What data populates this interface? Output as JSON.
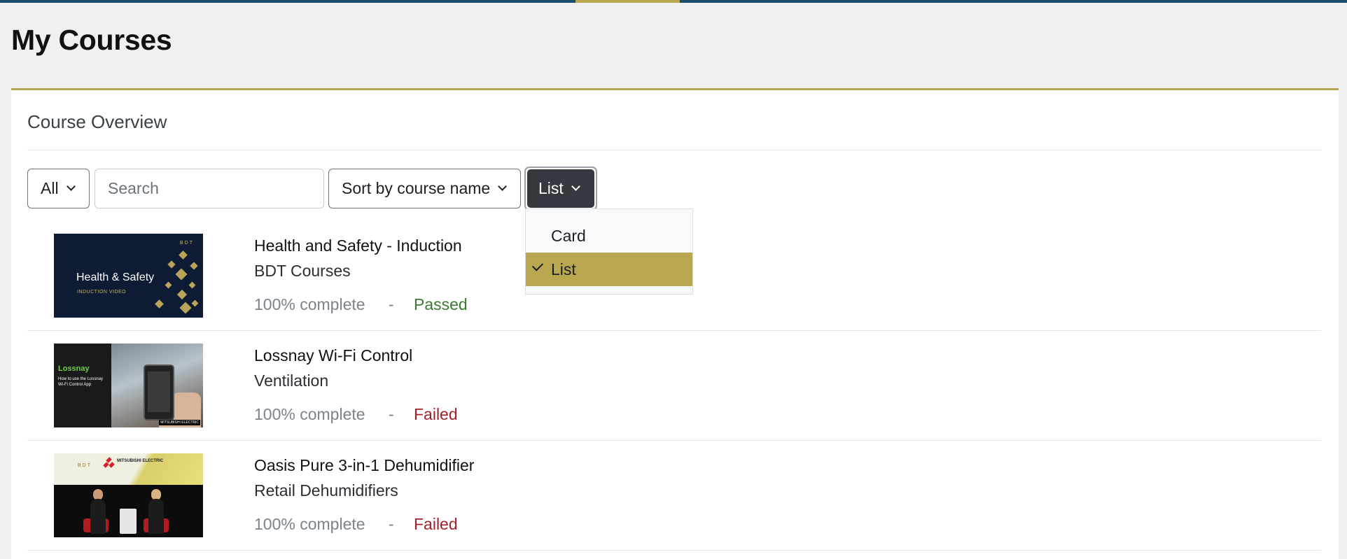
{
  "page": {
    "title": "My Courses"
  },
  "block": {
    "title": "Course Overview"
  },
  "controls": {
    "filter": {
      "label": "All"
    },
    "search": {
      "placeholder": "Search"
    },
    "sort": {
      "label": "Sort by course name"
    },
    "view": {
      "label": "List"
    }
  },
  "view_menu": {
    "options": [
      "Card",
      "List"
    ],
    "selected": "List"
  },
  "courses": [
    {
      "title": "Health and Safety - Induction",
      "category": "BDT Courses",
      "progress": "100% complete",
      "separator": "-",
      "status": "Passed",
      "thumb": {
        "title": "Health & Safety",
        "subtitle": "INDUCTION VIDEO",
        "logo": "BDT"
      }
    },
    {
      "title": "Lossnay Wi-Fi Control",
      "category": "Ventilation",
      "progress": "100% complete",
      "separator": "-",
      "status": "Failed",
      "thumb": {
        "logo": "Lossnay",
        "text": "How to use the Lossnay Wi-Fi Control App",
        "brand": "MITSUBISHI ELECTRIC"
      }
    },
    {
      "title": "Oasis Pure 3-in-1 Dehumidifier",
      "category": "Retail Dehumidifiers",
      "progress": "100% complete",
      "separator": "-",
      "status": "Failed",
      "thumb": {
        "logo": "BDT",
        "brand": "MITSUBISHI ELECTRIC"
      }
    }
  ],
  "colors": {
    "accent": "#b9a84f",
    "topbar": "#1c4f6e",
    "passed": "#3a7a30",
    "failed": "#a3202a",
    "dark_button": "#343a40"
  }
}
